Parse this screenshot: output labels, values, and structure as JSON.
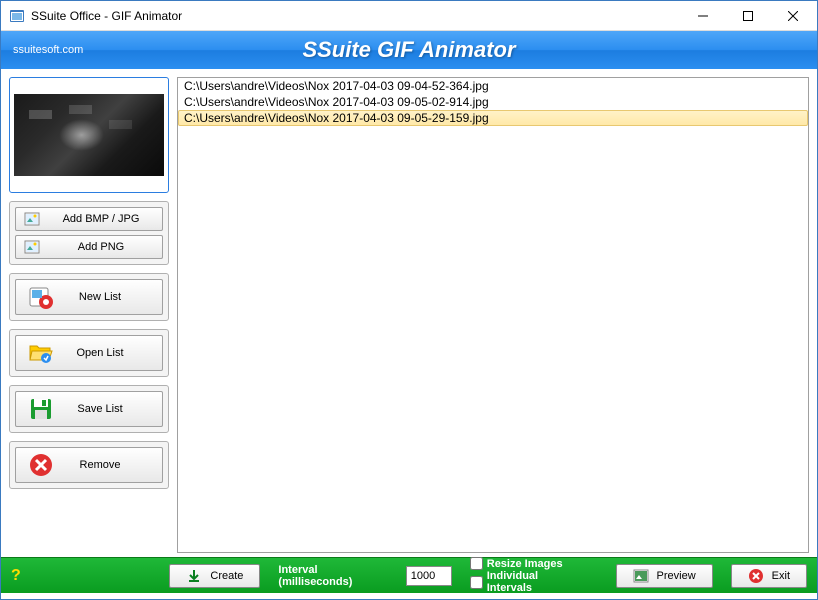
{
  "window": {
    "title": "SSuite Office - GIF Animator"
  },
  "banner": {
    "url": "ssuitesoft.com",
    "title": "SSuite GIF Animator"
  },
  "sidebar": {
    "addBmp": "Add BMP / JPG",
    "addPng": "Add PNG",
    "newList": "New List",
    "openList": "Open List",
    "saveList": "Save List",
    "remove": "Remove"
  },
  "files": [
    "C:\\Users\\andre\\Videos\\Nox 2017-04-03 09-04-52-364.jpg",
    "C:\\Users\\andre\\Videos\\Nox 2017-04-03 09-05-02-914.jpg",
    "C:\\Users\\andre\\Videos\\Nox 2017-04-03 09-05-29-159.jpg"
  ],
  "selectedIndex": 2,
  "bottom": {
    "help": "?",
    "create": "Create",
    "intervalLabel": "Interval (milliseconds)",
    "intervalValue": "1000",
    "resize": "Resize Images",
    "individual": "Individual Intervals",
    "preview": "Preview",
    "exit": "Exit"
  }
}
